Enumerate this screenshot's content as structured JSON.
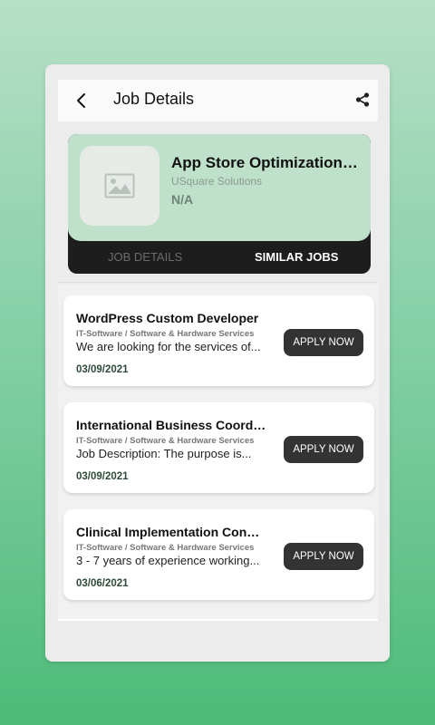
{
  "header": {
    "title": "Job Details"
  },
  "job": {
    "title": "App Store Optimization (...",
    "company": "USquare Solutions",
    "salary": "N/A"
  },
  "tabs": [
    {
      "label": "JOB DETAILS"
    },
    {
      "label": "SIMILAR JOBS"
    }
  ],
  "active_tab": "SIMILAR JOBS",
  "similar_jobs": [
    {
      "title": "WordPress Custom Developer",
      "category": "IT-Software / Software & Hardware Services",
      "description": "We are looking for the services of...",
      "date": "03/09/2021",
      "apply_label": "APPLY NOW"
    },
    {
      "title": "International Business Coordi...",
      "category": "IT-Software / Software & Hardware Services",
      "description": "Job Description:  The purpose is...",
      "date": "03/09/2021",
      "apply_label": "APPLY NOW"
    },
    {
      "title": "Clinical Implementation Consu...",
      "category": "IT-Software / Software & Hardware Services",
      "description": "3 - 7 years of experience working...",
      "date": "03/06/2021",
      "apply_label": "APPLY NOW"
    }
  ],
  "icons": {
    "back": "arrow-left-icon",
    "share": "share-icon",
    "thumbnail": "image-placeholder-icon"
  },
  "colors": {
    "accent_green": "#bfe1cb",
    "tab_bar": "#1d1d1d",
    "button": "#333333",
    "date": "#2f4a3a"
  }
}
